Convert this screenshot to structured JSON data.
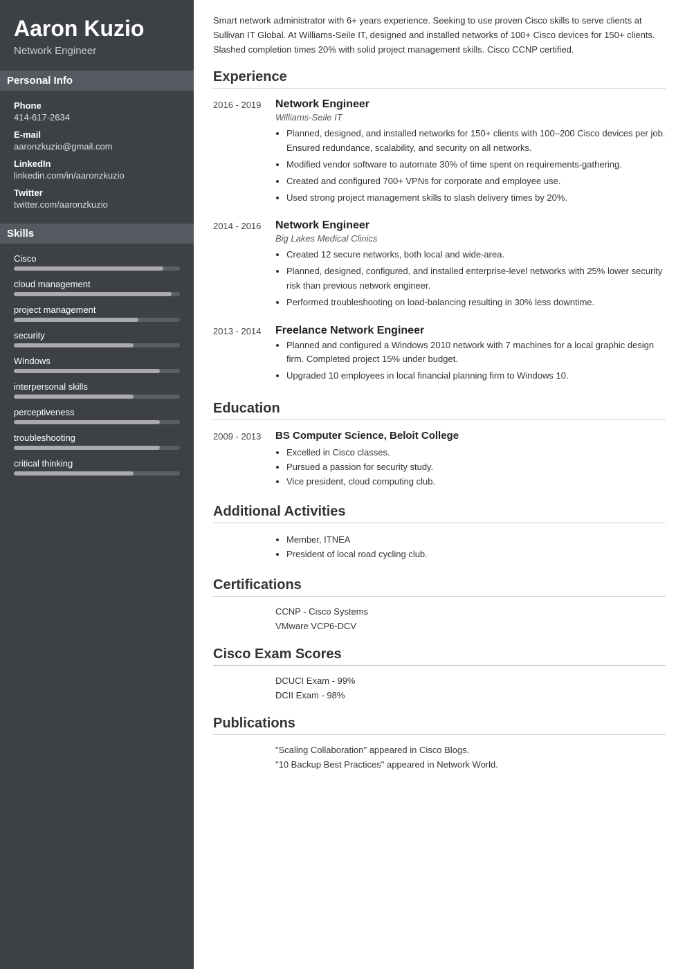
{
  "sidebar": {
    "name": "Aaron Kuzio",
    "job_title": "Network Engineer",
    "personal_info_label": "Personal Info",
    "phone_label": "Phone",
    "phone": "414-617-2634",
    "email_label": "E-mail",
    "email": "aaronzkuzio@gmail.com",
    "linkedin_label": "LinkedIn",
    "linkedin": "linkedin.com/in/aaronzkuzio",
    "twitter_label": "Twitter",
    "twitter": "twitter.com/aaronzkuzio",
    "skills_label": "Skills",
    "skills": [
      {
        "name": "Cisco",
        "fill_pct": 90,
        "trail_pct": 10
      },
      {
        "name": "cloud management",
        "fill_pct": 95,
        "trail_pct": 5
      },
      {
        "name": "project management",
        "fill_pct": 75,
        "trail_pct": 25
      },
      {
        "name": "security",
        "fill_pct": 72,
        "trail_pct": 28
      },
      {
        "name": "Windows",
        "fill_pct": 88,
        "trail_pct": 12
      },
      {
        "name": "interpersonal skills",
        "fill_pct": 72,
        "trail_pct": 28
      },
      {
        "name": "perceptiveness",
        "fill_pct": 88,
        "trail_pct": 12
      },
      {
        "name": "troubleshooting",
        "fill_pct": 88,
        "trail_pct": 12
      },
      {
        "name": "critical thinking",
        "fill_pct": 72,
        "trail_pct": 28
      }
    ]
  },
  "main": {
    "summary": "Smart network administrator with 6+ years experience. Seeking to use proven Cisco skills to serve clients at Sullivan IT Global. At Williams-Seile IT, designed and installed networks of 100+ Cisco devices for 150+ clients. Slashed completion times 20% with solid project management skills. Cisco CCNP certified.",
    "experience_label": "Experience",
    "experience": [
      {
        "dates": "2016 - 2019",
        "title": "Network Engineer",
        "company": "Williams-Seile IT",
        "bullets": [
          "Planned, designed, and installed networks for 150+ clients with 100–200 Cisco devices per job. Ensured redundance, scalability, and security on all networks.",
          "Modified vendor software to automate 30% of time spent on requirements-gathering.",
          "Created and configured 700+ VPNs for corporate and employee use.",
          "Used strong project management skills to slash delivery times by 20%."
        ]
      },
      {
        "dates": "2014 - 2016",
        "title": "Network Engineer",
        "company": "Big Lakes Medical Clinics",
        "bullets": [
          "Created 12 secure networks, both local and wide-area.",
          "Planned, designed, configured, and installed enterprise-level networks with 25% lower security risk than previous network engineer.",
          "Performed troubleshooting on load-balancing resulting in 30% less downtime."
        ]
      },
      {
        "dates": "2013 - 2014",
        "title": "Freelance Network Engineer",
        "company": "",
        "bullets": [
          "Planned and configured a Windows 2010 network with 7 machines for a local graphic design firm. Completed project 15% under budget.",
          "Upgraded 10 employees in local financial planning firm to Windows 10."
        ]
      }
    ],
    "education_label": "Education",
    "education": [
      {
        "dates": "2009 - 2013",
        "degree": "BS Computer Science, Beloit College",
        "bullets": [
          "Excelled in Cisco classes.",
          "Pursued a passion for security study.",
          "Vice president, cloud computing club."
        ]
      }
    ],
    "activities_label": "Additional Activities",
    "activities": [
      "Member, ITNEA",
      "President of local road cycling club."
    ],
    "certifications_label": "Certifications",
    "certifications": [
      "CCNP - Cisco Systems",
      "VMware VCP6-DCV"
    ],
    "exam_scores_label": "Cisco Exam Scores",
    "exam_scores": [
      "DCUCI Exam - 99%",
      "DCII Exam - 98%"
    ],
    "publications_label": "Publications",
    "publications": [
      "\"Scaling Collaboration\" appeared in Cisco Blogs.",
      "\"10 Backup Best Practices\" appeared in Network World."
    ]
  }
}
